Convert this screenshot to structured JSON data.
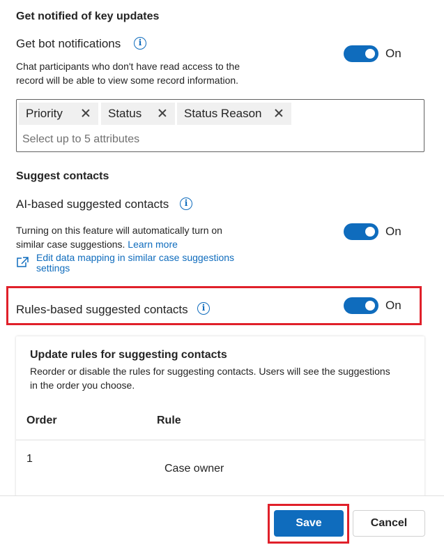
{
  "notifications": {
    "heading": "Get notified of key updates",
    "bot_label": "Get bot notifications",
    "bot_desc_1": "Chat participants who don't have read access to the",
    "bot_desc_2": "record will be able to view some record information.",
    "bot_toggle_state": "On",
    "attributes": [
      "Priority",
      "Status",
      "Status Reason"
    ],
    "attributes_placeholder": "Select up to 5 attributes"
  },
  "suggest": {
    "heading": "Suggest contacts",
    "ai_label": "AI-based suggested contacts",
    "ai_desc_1": "Turning on this feature will automatically turn on",
    "ai_desc_2": "similar case suggestions.",
    "learn_more": "Learn more",
    "edit_mapping_1": "Edit data mapping in similar case suggestions",
    "edit_mapping_2": "settings",
    "ai_toggle_state": "On",
    "rules_label": "Rules-based suggested contacts",
    "rules_toggle_state": "On"
  },
  "rules_card": {
    "title": "Update rules for suggesting contacts",
    "desc_1": "Reorder or disable the rules for suggesting contacts. Users will see the suggestions",
    "desc_2": "in the order you choose.",
    "col_order": "Order",
    "col_rule": "Rule",
    "rows": [
      {
        "order": "1",
        "rule": "Case owner"
      }
    ]
  },
  "footer": {
    "save": "Save",
    "cancel": "Cancel"
  },
  "colors": {
    "accent": "#0f6cbd",
    "highlight": "#e0202a"
  }
}
